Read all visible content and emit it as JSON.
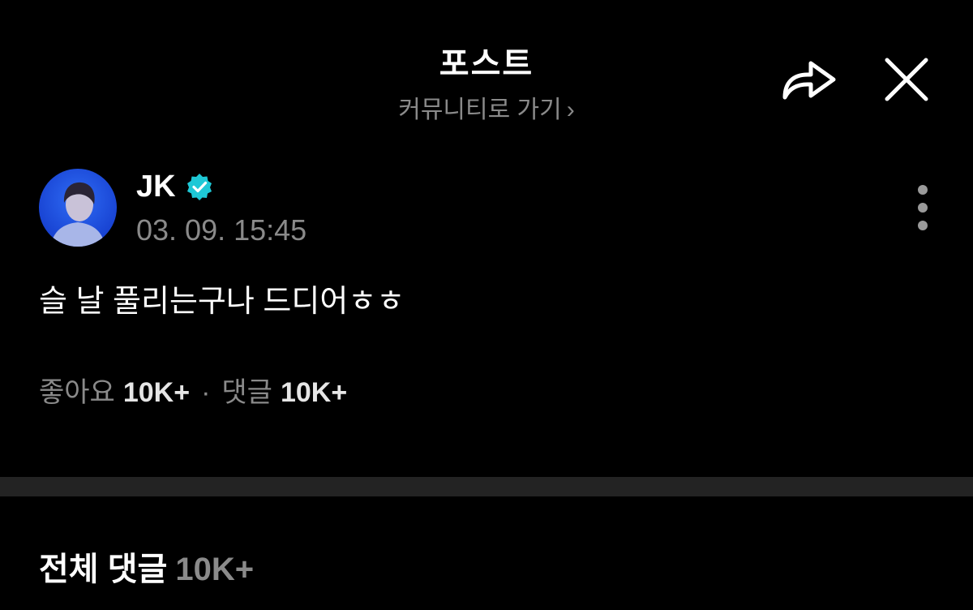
{
  "header": {
    "title": "포스트",
    "community_link": "커뮤니티로 가기",
    "community_chevron": "›"
  },
  "icons": {
    "share": "share-icon",
    "close": "close-icon",
    "verified": "verified-badge-icon",
    "more": "more-vertical-icon"
  },
  "post": {
    "author": "JK",
    "timestamp": "03. 09. 15:45",
    "body": "슬 날 풀리는구나 드디어ㅎㅎ",
    "likes_label": "좋아요",
    "likes_count": "10K+",
    "separator": "·",
    "comments_label": "댓글",
    "comments_count": "10K+"
  },
  "comments": {
    "title": "전체 댓글",
    "count": "10K+"
  },
  "colors": {
    "background": "#000000",
    "text": "#ffffff",
    "muted": "#8a8a8a",
    "verified": "#1ec8d6",
    "divider": "#232323"
  }
}
